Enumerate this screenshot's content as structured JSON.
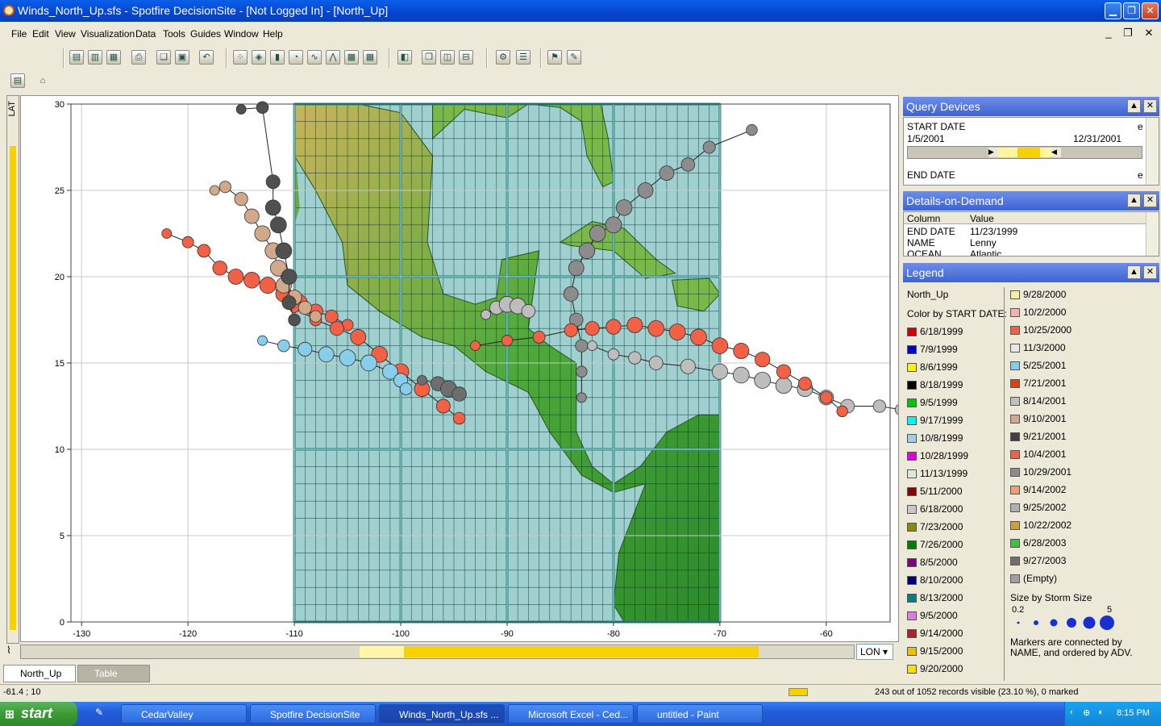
{
  "window": {
    "title": "Winds_North_Up.sfs - Spotfire DecisionSite - [Not Logged In] - [North_Up]",
    "minimize": "▁",
    "restore": "❐",
    "close": "✕"
  },
  "menu": [
    "File",
    "Edit",
    "View",
    "Visualization",
    "Data",
    "Tools",
    "Guides",
    "Window",
    "Help"
  ],
  "mdi_buttons": [
    "_",
    "❐",
    "✕"
  ],
  "plot": {
    "y_axis_label": "LAT",
    "x_axis_label": "LON",
    "x_ticks": [
      "-130",
      "-120",
      "-110",
      "-100",
      "-90",
      "-80",
      "-70",
      "-60"
    ],
    "y_ticks": [
      "0",
      "5",
      "10",
      "15",
      "20",
      "25",
      "30"
    ]
  },
  "chart_data": {
    "type": "scatter",
    "title": "",
    "xlabel": "LON",
    "ylabel": "LAT",
    "xlim": [
      -131,
      -54
    ],
    "ylim": [
      0,
      30
    ],
    "grid": true,
    "legend_placement": "right panel",
    "tracks": [
      {
        "date": "10/25/2000",
        "color": "#f26045",
        "points": [
          [
            -122,
            22.5
          ],
          [
            -120,
            22
          ],
          [
            -118.5,
            21.5
          ],
          [
            -117,
            20.5
          ],
          [
            -115.5,
            20
          ],
          [
            -114,
            19.8
          ],
          [
            -112.5,
            19.5
          ],
          [
            -111,
            19
          ],
          [
            -109.5,
            18.5
          ],
          [
            -108,
            18
          ],
          [
            -106.5,
            17.7
          ],
          [
            -105,
            17.2
          ]
        ]
      },
      {
        "date": "10/4/2001",
        "color": "#f26045",
        "points": [
          [
            -110,
            18.2
          ],
          [
            -108,
            17.5
          ],
          [
            -106,
            17
          ],
          [
            -104,
            16.5
          ],
          [
            -102,
            15.5
          ],
          [
            -100,
            14.5
          ],
          [
            -98,
            13.5
          ],
          [
            -96,
            12.5
          ],
          [
            -94.5,
            11.8
          ]
        ]
      },
      {
        "date": "5/25/2001",
        "color": "#87ceeb",
        "points": [
          [
            -113,
            16.3
          ],
          [
            -111,
            16
          ],
          [
            -109,
            15.8
          ],
          [
            -107,
            15.5
          ],
          [
            -105,
            15.3
          ],
          [
            -103,
            15
          ],
          [
            -101,
            14.5
          ],
          [
            -100,
            14
          ],
          [
            -99.5,
            13.5
          ]
        ]
      },
      {
        "date": "9/10/2001",
        "color": "#d2a88a",
        "points": [
          [
            -117.5,
            25
          ],
          [
            -116.5,
            25.2
          ],
          [
            -115,
            24.5
          ],
          [
            -114,
            23.5
          ],
          [
            -113,
            22.5
          ],
          [
            -112,
            21.5
          ],
          [
            -111.5,
            20.5
          ],
          [
            -111,
            19.5
          ],
          [
            -110,
            18.8
          ],
          [
            -109,
            18.2
          ],
          [
            -108,
            17.7
          ]
        ]
      },
      {
        "date": "9/21/2001",
        "color": "#505050",
        "points": [
          [
            -115,
            29.7
          ],
          [
            -113,
            29.8
          ],
          [
            -112,
            25.5
          ],
          [
            -112,
            24
          ],
          [
            -111.5,
            23
          ],
          [
            -111,
            21.5
          ],
          [
            -110.5,
            20
          ],
          [
            -110.5,
            18.5
          ],
          [
            -110,
            17.5
          ]
        ]
      },
      {
        "date": "8/14/2001",
        "color": "#6e6e6e",
        "points": [
          [
            -98,
            14
          ],
          [
            -96.5,
            13.8
          ],
          [
            -95.5,
            13.5
          ],
          [
            -94.5,
            13.2
          ]
        ]
      },
      {
        "date": "11/3/2000",
        "color": "#bdbdbd",
        "points": [
          [
            -92,
            17.8
          ],
          [
            -91,
            18.2
          ],
          [
            -90,
            18.4
          ],
          [
            -89,
            18.3
          ],
          [
            -88,
            18
          ]
        ]
      },
      {
        "date": "11/23/1999",
        "color": "#bdbdbd",
        "points": [
          [
            -82,
            16
          ],
          [
            -80,
            15.5
          ],
          [
            -78,
            15.3
          ],
          [
            -76,
            15
          ],
          [
            -73,
            14.8
          ],
          [
            -70,
            14.5
          ],
          [
            -68,
            14.3
          ],
          [
            -66,
            14
          ],
          [
            -64,
            13.7
          ],
          [
            -62,
            13.5
          ],
          [
            -60,
            13
          ],
          [
            -58,
            12.5
          ],
          [
            -55,
            12.5
          ],
          [
            -53,
            12.3
          ]
        ]
      },
      {
        "date": "10/29/2001",
        "color": "#8c8c8c",
        "points": [
          [
            -83,
            13
          ],
          [
            -83,
            14.5
          ],
          [
            -83,
            16
          ],
          [
            -83.5,
            17.5
          ],
          [
            -84,
            19
          ],
          [
            -83.5,
            20.5
          ],
          [
            -82.5,
            21.5
          ],
          [
            -81.5,
            22.5
          ],
          [
            -80,
            23
          ],
          [
            -79,
            24
          ],
          [
            -77,
            25
          ],
          [
            -75,
            26
          ],
          [
            -73,
            26.5
          ],
          [
            -71,
            27.5
          ],
          [
            -67,
            28.5
          ]
        ]
      },
      {
        "date": "9/27/2003",
        "color": "#f26045",
        "points": [
          [
            -93,
            16
          ],
          [
            -90,
            16.3
          ],
          [
            -87,
            16.5
          ],
          [
            -84,
            16.9
          ],
          [
            -82,
            17
          ],
          [
            -80,
            17.1
          ],
          [
            -78,
            17.2
          ],
          [
            -76,
            17
          ],
          [
            -74,
            16.8
          ],
          [
            -72,
            16.5
          ],
          [
            -70,
            16
          ],
          [
            -68,
            15.7
          ],
          [
            -66,
            15.2
          ],
          [
            -64,
            14.5
          ],
          [
            -62,
            13.8
          ],
          [
            -60,
            13
          ],
          [
            -58.5,
            12.2
          ]
        ]
      }
    ]
  },
  "query_devices": {
    "title": "Query Devices",
    "start_label": "START DATE",
    "start_min": "1/5/2001",
    "start_max": "12/31/2001",
    "end_label": "END DATE",
    "e_marker": "e"
  },
  "details": {
    "title": "Details-on-Demand",
    "col_header": "Column",
    "val_header": "Value",
    "rows": [
      {
        "col": "END DATE",
        "val": "11/23/1999"
      },
      {
        "col": "NAME",
        "val": "Lenny"
      },
      {
        "col": "OCEAN",
        "val": "Atlantic"
      }
    ]
  },
  "legend": {
    "title": "Legend",
    "view_name": "North_Up",
    "color_by": "Color by START DATE:",
    "left": [
      {
        "label": "6/18/1999",
        "color": "#d40000"
      },
      {
        "label": "7/9/1999",
        "color": "#0000d4"
      },
      {
        "label": "8/6/1999",
        "color": "#f5f500"
      },
      {
        "label": "8/18/1999",
        "color": "#000000"
      },
      {
        "label": "9/5/1999",
        "color": "#00c800"
      },
      {
        "label": "9/17/1999",
        "color": "#00f5f5"
      },
      {
        "label": "10/8/1999",
        "color": "#a6cbe8"
      },
      {
        "label": "10/28/1999",
        "color": "#e000e0"
      },
      {
        "label": "11/13/1999",
        "color": "#d8ecd8"
      },
      {
        "label": "5/11/2000",
        "color": "#8b0000"
      },
      {
        "label": "6/18/2000",
        "color": "#c8c8c8"
      },
      {
        "label": "7/23/2000",
        "color": "#8b8b00"
      },
      {
        "label": "7/26/2000",
        "color": "#008000"
      },
      {
        "label": "8/5/2000",
        "color": "#800080"
      },
      {
        "label": "8/10/2000",
        "color": "#000080"
      },
      {
        "label": "8/13/2000",
        "color": "#008080"
      },
      {
        "label": "9/5/2000",
        "color": "#e07ae0"
      },
      {
        "label": "9/14/2000",
        "color": "#b0202a"
      },
      {
        "label": "9/15/2000",
        "color": "#f0c000"
      },
      {
        "label": "9/20/2000",
        "color": "#f5e000"
      }
    ],
    "right": [
      {
        "label": "9/28/2000",
        "color": "#f5f0a0"
      },
      {
        "label": "10/2/2000",
        "color": "#f5b0b0"
      },
      {
        "label": "10/25/2000",
        "color": "#f26045"
      },
      {
        "label": "11/3/2000",
        "color": "#e8e8e8"
      },
      {
        "label": "5/25/2001",
        "color": "#87ceeb"
      },
      {
        "label": "7/21/2001",
        "color": "#e04010"
      },
      {
        "label": "8/14/2001",
        "color": "#c0c0c0"
      },
      {
        "label": "9/10/2001",
        "color": "#d2a88a"
      },
      {
        "label": "9/21/2001",
        "color": "#404040"
      },
      {
        "label": "10/4/2001",
        "color": "#f26045"
      },
      {
        "label": "10/29/2001",
        "color": "#8c8c8c"
      },
      {
        "label": "9/14/2002",
        "color": "#f0a070"
      },
      {
        "label": "9/25/2002",
        "color": "#b0b0b0"
      },
      {
        "label": "10/22/2002",
        "color": "#d0a030"
      },
      {
        "label": "6/28/2003",
        "color": "#40c040"
      },
      {
        "label": "9/27/2003",
        "color": "#707070"
      },
      {
        "label": "(Empty)",
        "color": "#a0a0a0"
      }
    ],
    "size_by": "Size by Storm Size",
    "size_min": "0.2",
    "size_max": "5",
    "note": "Markers are connected by NAME, and ordered by ADV."
  },
  "tabs": [
    "North_Up",
    "Table"
  ],
  "status": {
    "coords": "-61.4 ; 10",
    "records": "243 out of 1052 records visible (23.10 %), 0 marked"
  },
  "taskbar": {
    "start": "start",
    "tasks": [
      "CedarValley",
      "Spotfire DecisionSite",
      "Winds_North_Up.sfs ...",
      "Microsoft Excel - Ced...",
      "untitled - Paint"
    ],
    "clock": "8:15 PM"
  }
}
